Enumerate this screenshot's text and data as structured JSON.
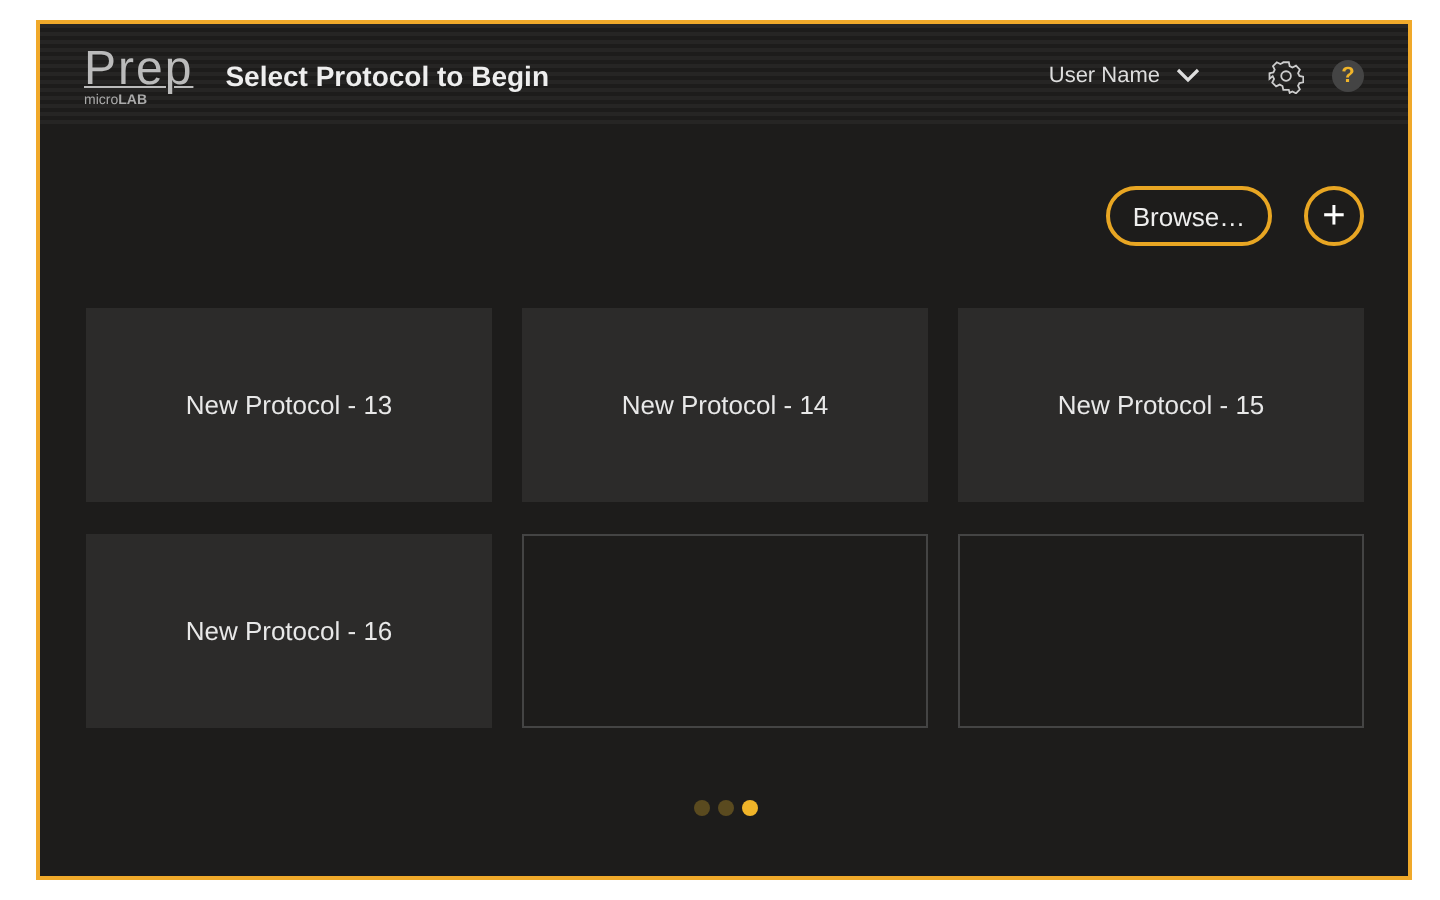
{
  "header": {
    "logo": "Prep",
    "logo_sub": "micro**LAB**",
    "title": "Select Protocol to Begin",
    "user": "User Name",
    "help": "?"
  },
  "actions": {
    "browse": "Browse…",
    "add": "+"
  },
  "tiles": [
    {
      "kind": "protocol",
      "label": "New Protocol - 13"
    },
    {
      "kind": "protocol",
      "label": "New Protocol - 14"
    },
    {
      "kind": "protocol",
      "label": "New Protocol - 15"
    },
    {
      "kind": "protocol",
      "label": "New Protocol - 16"
    },
    {
      "kind": "empty"
    },
    {
      "kind": "empty"
    }
  ],
  "pages": [
    {
      "selected": false
    },
    {
      "selected": false
    },
    {
      "selected": true
    }
  ]
}
